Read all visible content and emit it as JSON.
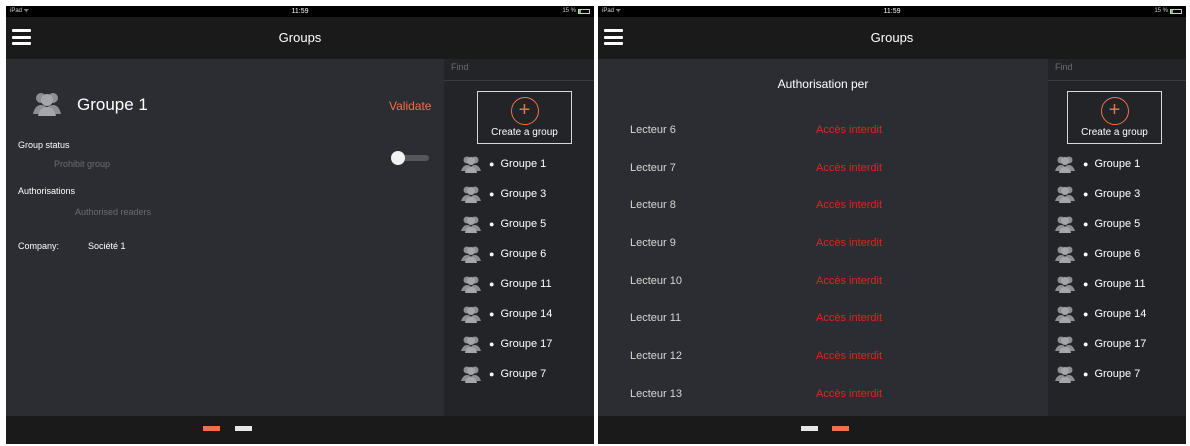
{
  "colors": {
    "accent": "#f36e4c",
    "denied": "#e2231a",
    "background": "#2c2d32",
    "panel": "#232428"
  },
  "statusbar": {
    "device": "iPad ᯤ",
    "time": "11:59",
    "battery": "15 %",
    "battery_fraction": 0.15
  },
  "header": {
    "title": "Groups"
  },
  "search": {
    "placeholder": "Find"
  },
  "create_group": {
    "label": "Create a group",
    "icon": "plus-circle-icon"
  },
  "groups": [
    "Groupe 1",
    "Groupe 3",
    "Groupe 5",
    "Groupe 6",
    "Groupe 11",
    "Groupe 14",
    "Groupe 17",
    "Groupe 7"
  ],
  "group_detail": {
    "name": "Groupe 1",
    "validate_label": "Validate",
    "status_label": "Group status",
    "prohibit_label": "Prohibit group",
    "prohibit_on": false,
    "authorisations_label": "Authorisations",
    "authorised_readers_label": "Authorised readers",
    "company_label": "Company:",
    "company_value": "Société 1"
  },
  "authorisation": {
    "title": "Authorisation per",
    "readers": [
      {
        "name": "Lecteur 6",
        "status": "Accès interdit"
      },
      {
        "name": "Lecteur 7",
        "status": "Accès interdit"
      },
      {
        "name": "Lecteur 8",
        "status": "Accès interdit"
      },
      {
        "name": "Lecteur 9",
        "status": "Accès interdit"
      },
      {
        "name": "Lecteur 10",
        "status": "Accès interdit"
      },
      {
        "name": "Lecteur 11",
        "status": "Accès interdit"
      },
      {
        "name": "Lecteur 12",
        "status": "Accès interdit"
      },
      {
        "name": "Lecteur 13",
        "status": "Accès interdit"
      }
    ]
  },
  "pager": {
    "page_count": 2,
    "left_screen_active_page": 1,
    "right_screen_active_page": 2
  }
}
